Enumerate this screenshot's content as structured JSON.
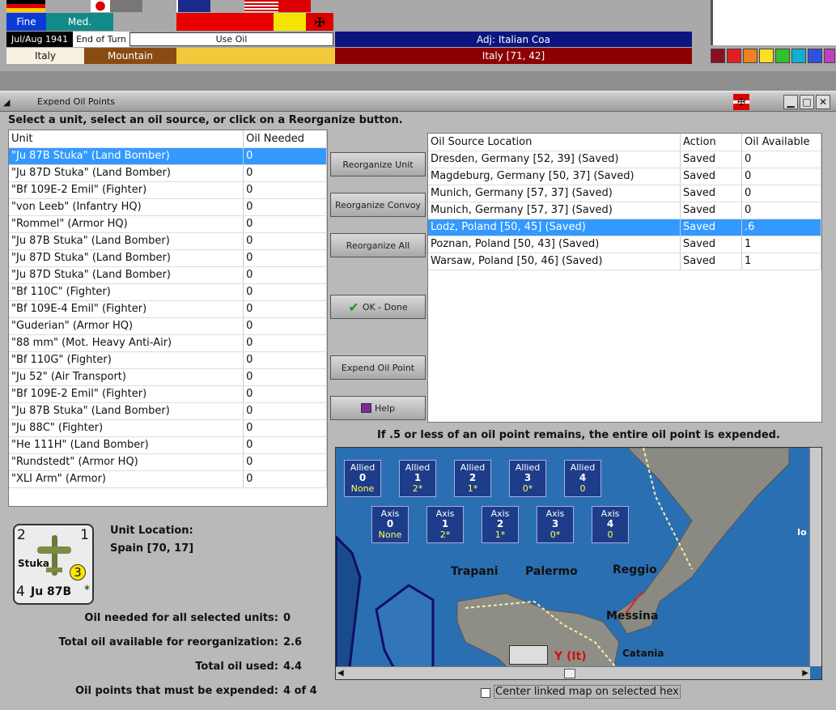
{
  "topbar": {
    "fine": "Fine",
    "med": "Med.",
    "date": "Jul/Aug 1941",
    "end_of_turn": "End of Turn",
    "use_oil": "Use Oil",
    "adj": "Adj: Italian Coa",
    "country": "Italy",
    "terrain": "Mountain",
    "hex": "Italy [71, 42]"
  },
  "window": {
    "title": "Expend Oil Points",
    "instruction": "Select a unit, select an oil source, or click on a Reorganize button."
  },
  "units": {
    "headers": [
      "Unit",
      "Oil Needed"
    ],
    "rows": [
      [
        "\"Ju 87B Stuka\" (Land Bomber)",
        "0"
      ],
      [
        "\"Ju 87D Stuka\" (Land Bomber)",
        "0"
      ],
      [
        "\"Bf 109E-2 Emil\" (Fighter)",
        "0"
      ],
      [
        "\"von Leeb\" (Infantry HQ)",
        "0"
      ],
      [
        "\"Rommel\" (Armor HQ)",
        "0"
      ],
      [
        "\"Ju 87B Stuka\" (Land Bomber)",
        "0"
      ],
      [
        "\"Ju 87D Stuka\" (Land Bomber)",
        "0"
      ],
      [
        "\"Ju 87D Stuka\" (Land Bomber)",
        "0"
      ],
      [
        "\"Bf 110C\" (Fighter)",
        "0"
      ],
      [
        "\"Bf 109E-4 Emil\" (Fighter)",
        "0"
      ],
      [
        "\"Guderian\" (Armor HQ)",
        "0"
      ],
      [
        "\"88 mm\" (Mot. Heavy Anti-Air)",
        "0"
      ],
      [
        "\"Bf 110G\" (Fighter)",
        "0"
      ],
      [
        "\"Ju 52\" (Air Transport)",
        "0"
      ],
      [
        "\"Bf 109E-2 Emil\" (Fighter)",
        "0"
      ],
      [
        "\"Ju 87B Stuka\" (Land Bomber)",
        "0"
      ],
      [
        "\"Ju 88C\" (Fighter)",
        "0"
      ],
      [
        "\"He 111H\" (Land Bomber)",
        "0"
      ],
      [
        "\"Rundstedt\" (Armor HQ)",
        "0"
      ],
      [
        "\"XLI Arm\" (Armor)",
        "0"
      ]
    ]
  },
  "buttons": {
    "reorganize_unit": "Reorganize Unit",
    "reorganize_convoy": "Reorganize Convoy",
    "reorganize_all": "Reorganize All",
    "ok_done": "OK - Done",
    "expend": "Expend Oil Point",
    "help": "Help"
  },
  "sources": {
    "headers": [
      "Oil Source Location",
      "Action",
      "Oil Available"
    ],
    "rows": [
      [
        "Dresden, Germany [52, 39] (Saved)",
        "Saved",
        "0"
      ],
      [
        "Magdeburg, Germany [50, 37] (Saved)",
        "Saved",
        "0"
      ],
      [
        "Munich, Germany [57, 37] (Saved)",
        "Saved",
        "0"
      ],
      [
        "Munich, Germany [57, 37] (Saved)",
        "Saved",
        "0"
      ],
      [
        "Lodz, Poland [50, 45] (Saved)",
        "Saved",
        ".6"
      ],
      [
        "Poznan, Poland [50, 43] (Saved)",
        "Saved",
        "1"
      ],
      [
        "Warsaw, Poland [50, 46] (Saved)",
        "Saved",
        "1"
      ]
    ]
  },
  "note": "If .5 or less of an oil point remains, the entire oil point is expended.",
  "unit_info": {
    "location_label": "Unit Location:",
    "location": "Spain [70, 17]",
    "counter": {
      "tl": "2",
      "tr": "1",
      "name": "Stuka",
      "bl": "4",
      "type": "Ju 87B",
      "badge": "3",
      "star": "*"
    }
  },
  "summary": {
    "needed_label": "Oil needed for all selected units:",
    "needed": "0",
    "available_label": "Total oil available for reorganization:",
    "available": "2.6",
    "used_label": "Total oil used:",
    "used": "4.4",
    "must_label": "Oil points that must be expended:",
    "must": "4 of 4"
  },
  "map": {
    "allied": [
      {
        "label": "Allied",
        "n": "0",
        "s": "None"
      },
      {
        "label": "Allied",
        "n": "1",
        "s": "2*"
      },
      {
        "label": "Allied",
        "n": "2",
        "s": "1*"
      },
      {
        "label": "Allied",
        "n": "3",
        "s": "0*"
      },
      {
        "label": "Allied",
        "n": "4",
        "s": "0"
      }
    ],
    "axis": [
      {
        "label": "Axis",
        "n": "0",
        "s": "None"
      },
      {
        "label": "Axis",
        "n": "1",
        "s": "2*"
      },
      {
        "label": "Axis",
        "n": "2",
        "s": "1*"
      },
      {
        "label": "Axis",
        "n": "3",
        "s": "0*"
      },
      {
        "label": "Axis",
        "n": "4",
        "s": "0"
      }
    ],
    "cities": {
      "trapani": "Trapani",
      "palermo": "Palermo",
      "reggio": "Reggio",
      "messina": "Messina",
      "catania": "Catania"
    },
    "sicily_label": "Y (It)",
    "edge_label": "Io"
  },
  "center_linked": "Center linked map on selected hex"
}
